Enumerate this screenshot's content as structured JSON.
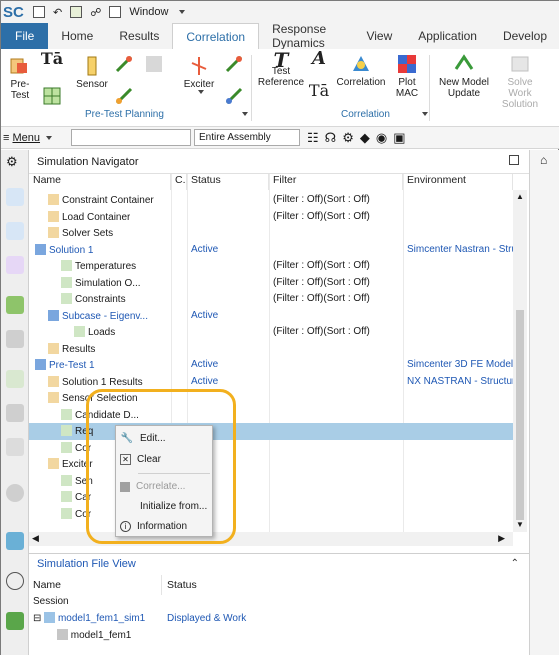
{
  "quick_access": {
    "app_logo": "SC",
    "window_label": "Window"
  },
  "tabs": [
    {
      "label": "File"
    },
    {
      "label": "Home"
    },
    {
      "label": "Results"
    },
    {
      "label": "Correlation"
    },
    {
      "label": "Response Dynamics"
    },
    {
      "label": "View"
    },
    {
      "label": "Application"
    },
    {
      "label": "Develop"
    }
  ],
  "active_tab": "Correlation",
  "ribbon": {
    "pre_test_label": "Pre-Test",
    "sensor_label": "Sensor",
    "exciter_label": "Exciter",
    "pre_test_planning_group": "Pre-Test Planning",
    "test_reference_label": "Test\nReference",
    "correlation_label": "Correlation",
    "plot_mac_label": "Plot\nMAC",
    "correlation_group": "Correlation",
    "new_model_update_label": "New Model\nUpdate",
    "solve_work_label": "Solve Work\nSolution"
  },
  "toolbar2": {
    "menu_label": "Menu",
    "filter_combo": "",
    "assembly_combo": "Entire Assembly"
  },
  "navigator": {
    "title": "Simulation Navigator",
    "columns": [
      "Name",
      "C.",
      "Status",
      "Filter",
      "Environment"
    ],
    "rows": [
      {
        "name": "Constraint Container",
        "status": "",
        "filter": "(Filter : Off)(Sort : Off)",
        "env": "",
        "indent": 1,
        "blue": false
      },
      {
        "name": "Load Container",
        "status": "",
        "filter": "(Filter : Off)(Sort : Off)",
        "env": "",
        "indent": 1,
        "blue": false
      },
      {
        "name": "Solver Sets",
        "status": "",
        "filter": "",
        "env": "",
        "indent": 1,
        "blue": false
      },
      {
        "name": "Solution 1",
        "status": "Active",
        "filter": "",
        "env": "Simcenter Nastran - Stru",
        "indent": 0,
        "blue": true
      },
      {
        "name": "Temperatures",
        "status": "",
        "filter": "(Filter : Off)(Sort : Off)",
        "env": "",
        "indent": 2,
        "blue": false
      },
      {
        "name": "Simulation O...",
        "status": "",
        "filter": "(Filter : Off)(Sort : Off)",
        "env": "",
        "indent": 2,
        "blue": false
      },
      {
        "name": "Constraints",
        "status": "",
        "filter": "(Filter : Off)(Sort : Off)",
        "env": "",
        "indent": 2,
        "blue": false
      },
      {
        "name": "Subcase - Eigenv...",
        "status": "Active",
        "filter": "",
        "env": "",
        "indent": 1,
        "blue": true
      },
      {
        "name": "Loads",
        "status": "",
        "filter": "(Filter : Off)(Sort : Off)",
        "env": "",
        "indent": 3,
        "blue": false
      },
      {
        "name": "Results",
        "status": "",
        "filter": "",
        "env": "",
        "indent": 1,
        "blue": false
      },
      {
        "name": "Pre-Test 1",
        "status": "Active",
        "filter": "",
        "env": "Simcenter 3D FE Model I",
        "indent": 0,
        "blue": true
      },
      {
        "name": "Solution 1 Results",
        "status": "Active",
        "filter": "",
        "env": "NX NASTRAN - Structur",
        "indent": 1,
        "blue": false
      },
      {
        "name": "Sensor Selection",
        "status": "",
        "filter": "",
        "env": "",
        "indent": 1,
        "blue": false
      },
      {
        "name": "Candidate D...",
        "status": "",
        "filter": "",
        "env": "",
        "indent": 2,
        "blue": false
      },
      {
        "name": "Req",
        "status": "",
        "filter": "",
        "env": "",
        "indent": 2,
        "blue": false
      },
      {
        "name": "Cor",
        "status": "",
        "filter": "",
        "env": "",
        "indent": 2,
        "blue": false
      },
      {
        "name": "Exciter",
        "status": "",
        "filter": "",
        "env": "",
        "indent": 1,
        "blue": false
      },
      {
        "name": "Sen",
        "status": "",
        "filter": "",
        "env": "",
        "indent": 2,
        "blue": false
      },
      {
        "name": "Car",
        "status": "",
        "filter": "",
        "env": "",
        "indent": 2,
        "blue": false
      },
      {
        "name": "Cor",
        "status": "",
        "filter": "",
        "env": "",
        "indent": 2,
        "blue": false
      }
    ]
  },
  "context_menu": {
    "items": [
      {
        "label": "Edit...",
        "icon": "wrench-icon",
        "disabled": false
      },
      {
        "label": "Clear",
        "icon": "clear-icon",
        "disabled": false
      },
      {
        "label": "Correlate...",
        "icon": "correlate-icon",
        "disabled": true
      },
      {
        "label": "Initialize from...",
        "icon": "",
        "disabled": false
      },
      {
        "label": "Information",
        "icon": "info-icon",
        "disabled": false
      }
    ]
  },
  "simulation_file_view": {
    "title": "Simulation File View",
    "columns": [
      "Name",
      "Status"
    ],
    "session_label": "Session",
    "rows": [
      {
        "name": "model1_fem1_sim1",
        "status": "Displayed & Work"
      },
      {
        "name": "model1_fem1",
        "status": ""
      }
    ]
  },
  "colors": {
    "accent": "#2d6fa8",
    "selection": "#a9cde6",
    "highlight": "#f2b01e",
    "link_blue": "#1f58b4"
  }
}
